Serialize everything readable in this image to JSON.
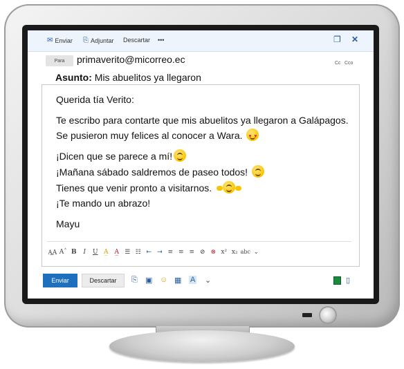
{
  "toolbar": {
    "send_label": "Enviar",
    "attach_label": "Adjuntar",
    "discard_label": "Descartar",
    "more_label": "•••",
    "icons": [
      "send-icon",
      "paperclip-icon",
      "popout-icon",
      "close-icon"
    ]
  },
  "header": {
    "to_button": "Para",
    "to_value": "primaverito@micorreo.ec",
    "cc_label": "Cc",
    "cco_label": "Cco",
    "subject_label": "Asunto:",
    "subject_value": "Mis abuelitos ya llegaron"
  },
  "message": {
    "greeting": "Querida tía Verito:",
    "line1": "Te escribo para contarte que mis abuelitos ya llegaron a Galápagos.",
    "line2": "Se pusieron muy felices al conocer a Wara.",
    "line3": "¡Dicen que se parece a mí!",
    "line4": "¡Mañana sábado saldremos de paseo todos!",
    "line5": "Tienes que venir pronto a visitarnos.",
    "line6": "¡Te mando un abrazo!",
    "signature": "Mayu"
  },
  "format_bar": [
    "A͟A",
    "Aˆ",
    "B",
    "I",
    "U",
    "A̲",
    "A̲",
    "☰",
    "☷",
    "⇤",
    "⇥",
    "≡",
    "≡",
    "≡",
    "⊘",
    "⊗",
    "x²",
    "x₂",
    "abc",
    "⌄"
  ],
  "footer": {
    "send_label": "Enviar",
    "discard_label": "Descartar",
    "icons": [
      "paperclip-icon",
      "image-icon",
      "emoji-icon",
      "calendar-icon",
      "text-format-icon",
      "chevron-down-icon",
      "green-app-icon",
      "document-icon"
    ]
  },
  "colors": {
    "accent": "#1f6fbf",
    "toolbar_bg": "#eef4fb"
  }
}
